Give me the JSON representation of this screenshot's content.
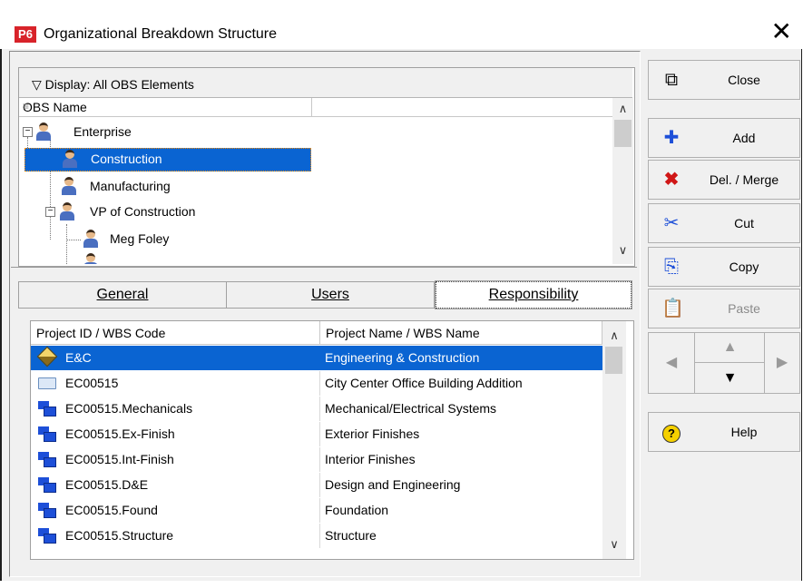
{
  "window": {
    "app_badge": "P6",
    "title": "Organizational Breakdown Structure",
    "close_glyph": "✕"
  },
  "obs": {
    "display_label": "▽ Display: All OBS Elements",
    "column_header": "OBS Name",
    "rows": [
      {
        "label": "Enterprise"
      },
      {
        "label": "Construction"
      },
      {
        "label": "Manufacturing"
      },
      {
        "label": "VP of Construction"
      },
      {
        "label": "Meg Foley"
      }
    ]
  },
  "tabs": {
    "general": "General",
    "users": "Users",
    "responsibility": "Responsibility"
  },
  "responsibility": {
    "columns": [
      "Project ID / WBS Code",
      "Project Name / WBS Name"
    ],
    "rows": [
      {
        "code": "E&C",
        "name": "Engineering & Construction",
        "icon": "project-diamond-icon"
      },
      {
        "code": "EC00515",
        "name": "City Center Office Building Addition",
        "icon": "folder-icon"
      },
      {
        "code": "EC00515.Mechanicals",
        "name": "Mechanical/Electrical Systems",
        "icon": "wbs-icon"
      },
      {
        "code": "EC00515.Ex-Finish",
        "name": "Exterior Finishes",
        "icon": "wbs-icon"
      },
      {
        "code": "EC00515.Int-Finish",
        "name": "Interior Finishes",
        "icon": "wbs-icon"
      },
      {
        "code": "EC00515.D&E",
        "name": "Design and Engineering",
        "icon": "wbs-icon"
      },
      {
        "code": "EC00515.Found",
        "name": "Foundation",
        "icon": "wbs-icon"
      },
      {
        "code": "EC00515.Structure",
        "name": "Structure",
        "icon": "wbs-icon"
      }
    ]
  },
  "side_buttons": {
    "close": "Close",
    "add": "Add",
    "del_merge": "Del. / Merge",
    "cut": "Cut",
    "copy": "Copy",
    "paste": "Paste",
    "help": "Help"
  },
  "colors": {
    "selection": "#0a64d2",
    "badge": "#d8232a"
  }
}
